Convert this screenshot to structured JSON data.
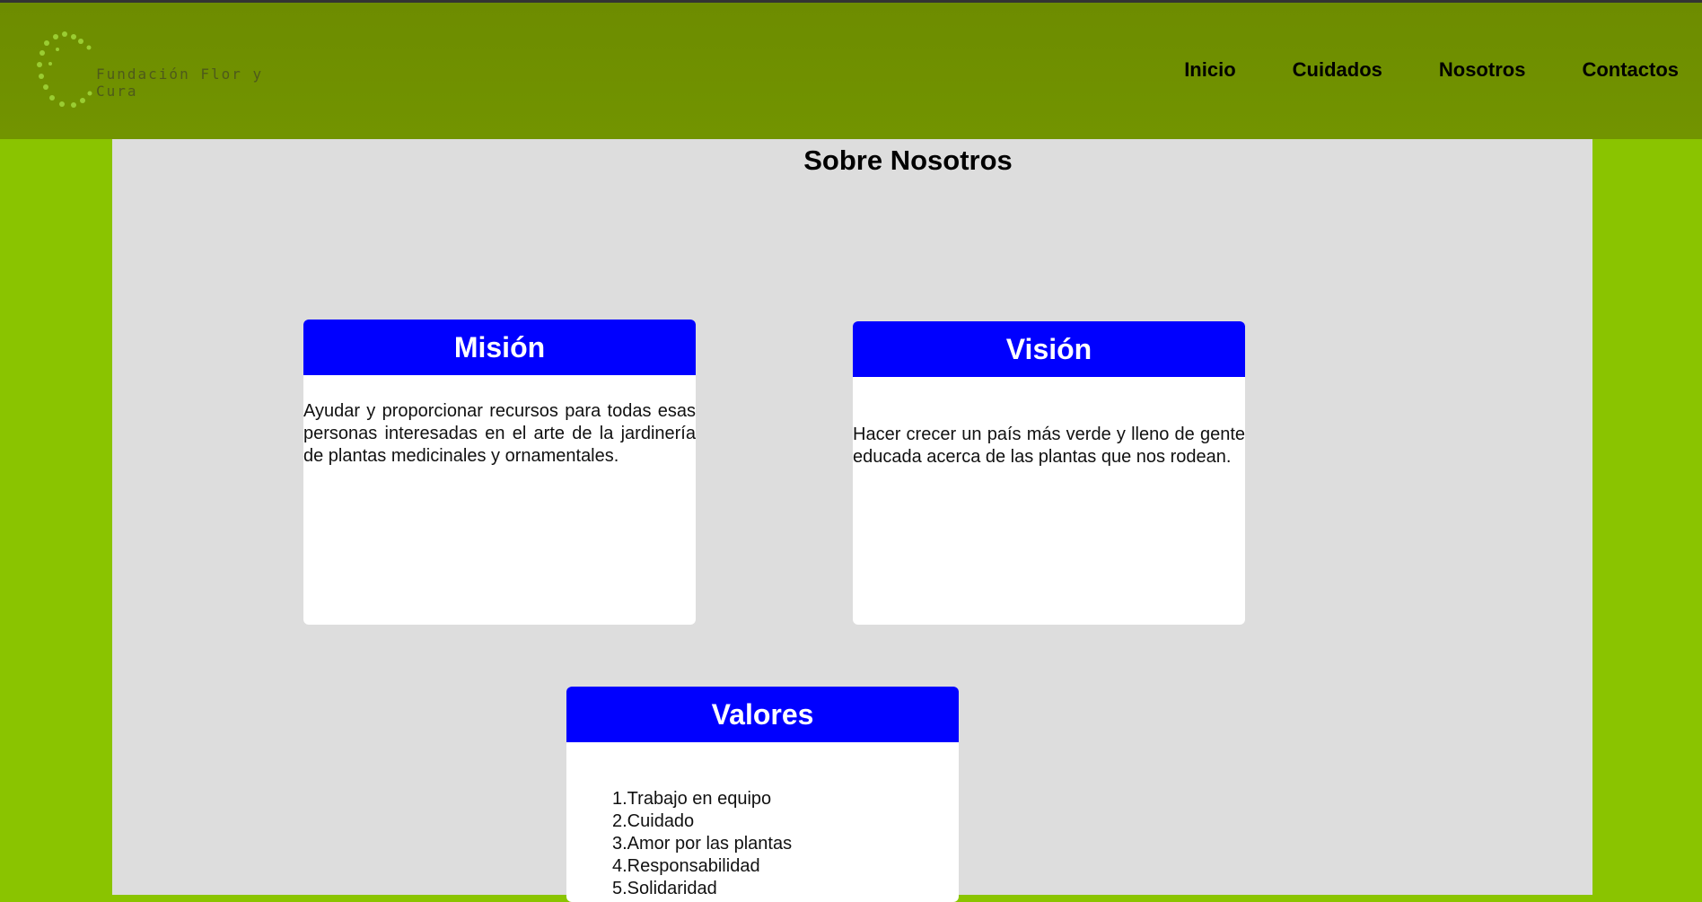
{
  "header": {
    "logo_text": "Fundación Flor y Cura",
    "nav": [
      "Inicio",
      "Cuidados",
      "Nosotros",
      "Contactos"
    ]
  },
  "main": {
    "title": "Sobre Nosotros",
    "cards": {
      "mision": {
        "title": "Misión",
        "text": "Ayudar y proporcionar recursos para todas esas personas interesadas en el arte de la jardinería de plantas medicinales y ornamentales."
      },
      "vision": {
        "title": "Visión",
        "text": "Hacer crecer un país más verde y lleno de gente educada acerca de las plantas que nos rodean."
      },
      "valores": {
        "title": "Valores",
        "items": [
          "1.Trabajo en equipo",
          "2.Cuidado",
          "3.Amor por las plantas",
          "4.Responsabilidad",
          "5.Solidaridad"
        ]
      }
    }
  },
  "colors": {
    "header_bg": "#729400",
    "page_bg": "#8ac400",
    "content_bg": "#dddddd",
    "card_header": "#0000ff",
    "logo_dots": "#9acd32"
  }
}
